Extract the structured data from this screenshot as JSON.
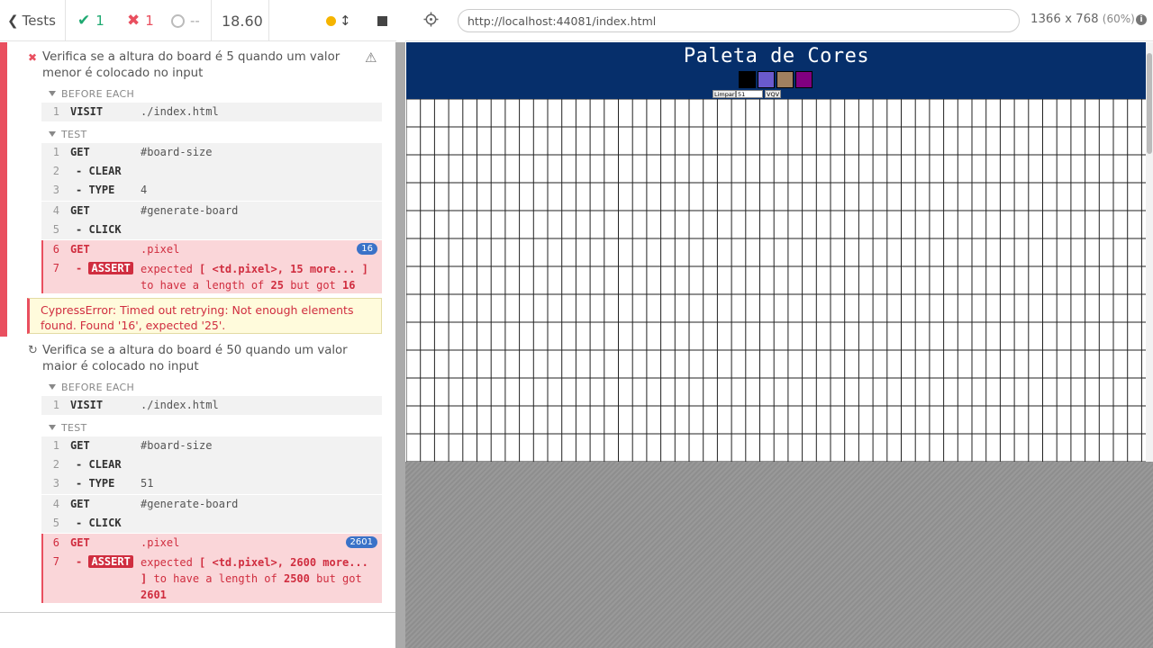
{
  "stats": {
    "tests_label": "Tests",
    "passed": "1",
    "failed": "1",
    "pending": "--",
    "duration": "18.60"
  },
  "tests": [
    {
      "title": "Verifica se a altura do board é 5 quando um valor menor é colocado no input",
      "state": "failed",
      "before_each_label": "BEFORE EACH",
      "before_each": [
        {
          "num": "1",
          "name": "VISIT",
          "message": "./index.html"
        }
      ],
      "test_label": "TEST",
      "commands": [
        {
          "num": "1",
          "name": "GET",
          "message": "#board-size"
        },
        {
          "num": "2",
          "name": "- CLEAR",
          "message": ""
        },
        {
          "num": "3",
          "name": "- TYPE",
          "message": "4"
        },
        {
          "num": "4",
          "name": "GET",
          "message": "#generate-board"
        },
        {
          "num": "5",
          "name": "- CLICK",
          "message": ""
        },
        {
          "num": "6",
          "name": "GET",
          "message": ".pixel",
          "count": "16"
        },
        {
          "num": "7",
          "name": "ASSERT",
          "prefix": "-",
          "expected_word": "expected",
          "subject": "[ <td.pixel>, 15 more... ]",
          "middle": "to have a length of",
          "expected_value": "25",
          "but_got": "but got",
          "actual_value": "16"
        }
      ],
      "error": "CypressError: Timed out retrying: Not enough elements found. Found '16', expected '25'."
    },
    {
      "title": "Verifica se a altura do board é 50 quando um valor maior é colocado no input",
      "state": "running",
      "before_each_label": "BEFORE EACH",
      "before_each": [
        {
          "num": "1",
          "name": "VISIT",
          "message": "./index.html"
        }
      ],
      "test_label": "TEST",
      "commands": [
        {
          "num": "1",
          "name": "GET",
          "message": "#board-size"
        },
        {
          "num": "2",
          "name": "- CLEAR",
          "message": ""
        },
        {
          "num": "3",
          "name": "- TYPE",
          "message": "51"
        },
        {
          "num": "4",
          "name": "GET",
          "message": "#generate-board"
        },
        {
          "num": "5",
          "name": "- CLICK",
          "message": ""
        },
        {
          "num": "6",
          "name": "GET",
          "message": ".pixel",
          "count": "2601"
        },
        {
          "num": "7",
          "name": "ASSERT",
          "prefix": "-",
          "expected_word": "expected",
          "subject_a": "[ <td.pixel>, 2600 more...",
          "subject_b": "]",
          "middle": "to have a length of",
          "expected_value": "2500",
          "but_got": "but got",
          "actual_value": "2601"
        }
      ]
    }
  ],
  "aut": {
    "url": "http://localhost:44081/index.html",
    "viewport": "1366 x 768",
    "zoom": "(60%)",
    "app_title": "Paleta de Cores",
    "palette_colors": [
      "#000000",
      "#6a5acd",
      "#a08060",
      "#800080"
    ],
    "clear_button": "Limpar",
    "board_size_value": "51",
    "generate_button": "VQV"
  },
  "colors": {
    "fail": "#e94f5f",
    "pass": "#1fa971",
    "header_bg": "#062f6b"
  }
}
